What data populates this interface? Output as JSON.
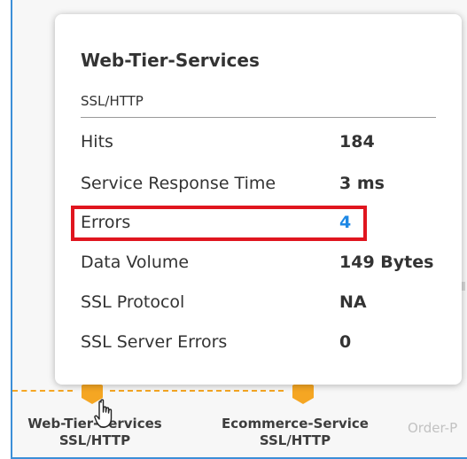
{
  "tooltip": {
    "title": "Web-Tier-Services",
    "subtitle": "SSL/HTTP",
    "rows": [
      {
        "key": "Hits",
        "value": "184"
      },
      {
        "key": "Service Response Time",
        "value": "3 ms"
      },
      {
        "key": "Errors",
        "value": "4"
      },
      {
        "key": "Data Volume",
        "value": "149 Bytes"
      },
      {
        "key": "SSL Protocol",
        "value": "NA"
      },
      {
        "key": "SSL Server Errors",
        "value": "0"
      }
    ]
  },
  "nodes": [
    {
      "name": "Web-Tier-Services",
      "protocol": "SSL/HTTP"
    },
    {
      "name": "Ecommerce-Service",
      "protocol": "SSL/HTTP"
    },
    {
      "name": "Order-P"
    }
  ],
  "colors": {
    "node": "#f5a623",
    "link_value": "#1e88e5",
    "highlight": "#e0151f",
    "frame_border": "#3c8fd8"
  }
}
